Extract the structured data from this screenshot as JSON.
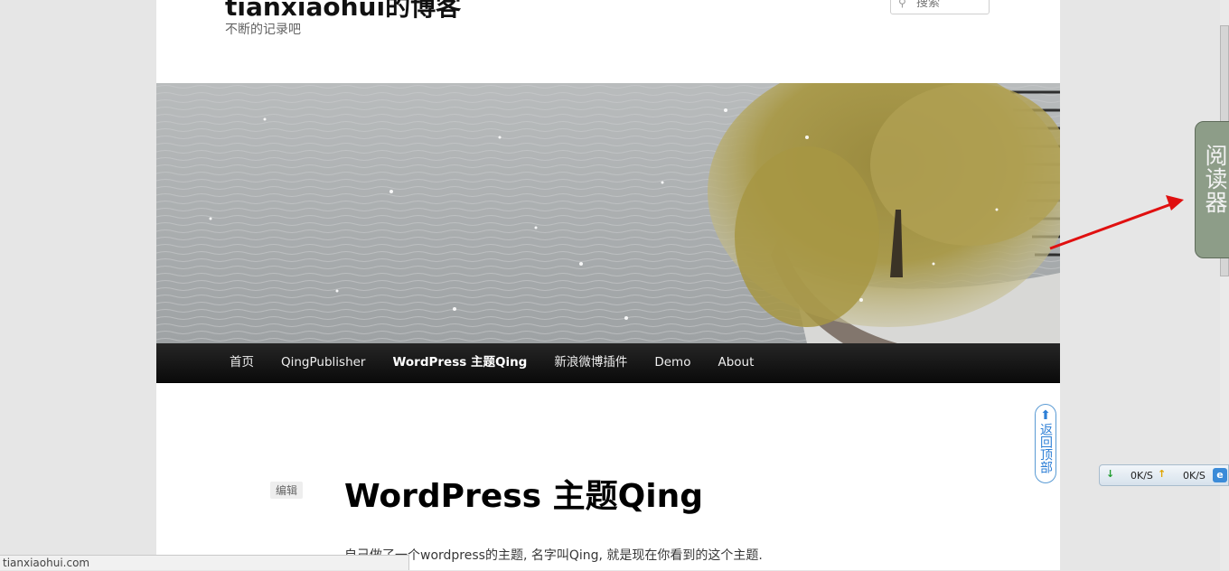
{
  "header": {
    "site_title": "tianxiaohui的博客",
    "site_description": "不断的记录吧",
    "search_placeholder": "搜索",
    "search_icon": "search-icon"
  },
  "nav": {
    "items": [
      {
        "label": "首页",
        "current": false
      },
      {
        "label": "QingPublisher",
        "current": false
      },
      {
        "label": "WordPress 主题Qing",
        "current": true
      },
      {
        "label": "新浪微博插件",
        "current": false
      },
      {
        "label": "Demo",
        "current": false
      },
      {
        "label": "About",
        "current": false
      }
    ]
  },
  "post": {
    "edit_label": "编辑",
    "title": "WordPress 主题Qing",
    "text_line_1": "自己做了一个wordpress的主题, 名字叫Qing, 就是现在你看到的这个主题."
  },
  "widgets": {
    "back_to_top_label": "返回顶部",
    "reader_tab_label": "阅读器",
    "download_speed": "0K/S",
    "upload_speed": "0K/S"
  },
  "status_bar": {
    "url": "tianxiaohui.com"
  },
  "colors": {
    "nav_bg": "#111111",
    "reader_tab_bg": "#8d9d88",
    "annotation_arrow": "#e01010",
    "back_to_top_blue": "#2d7fd6"
  }
}
